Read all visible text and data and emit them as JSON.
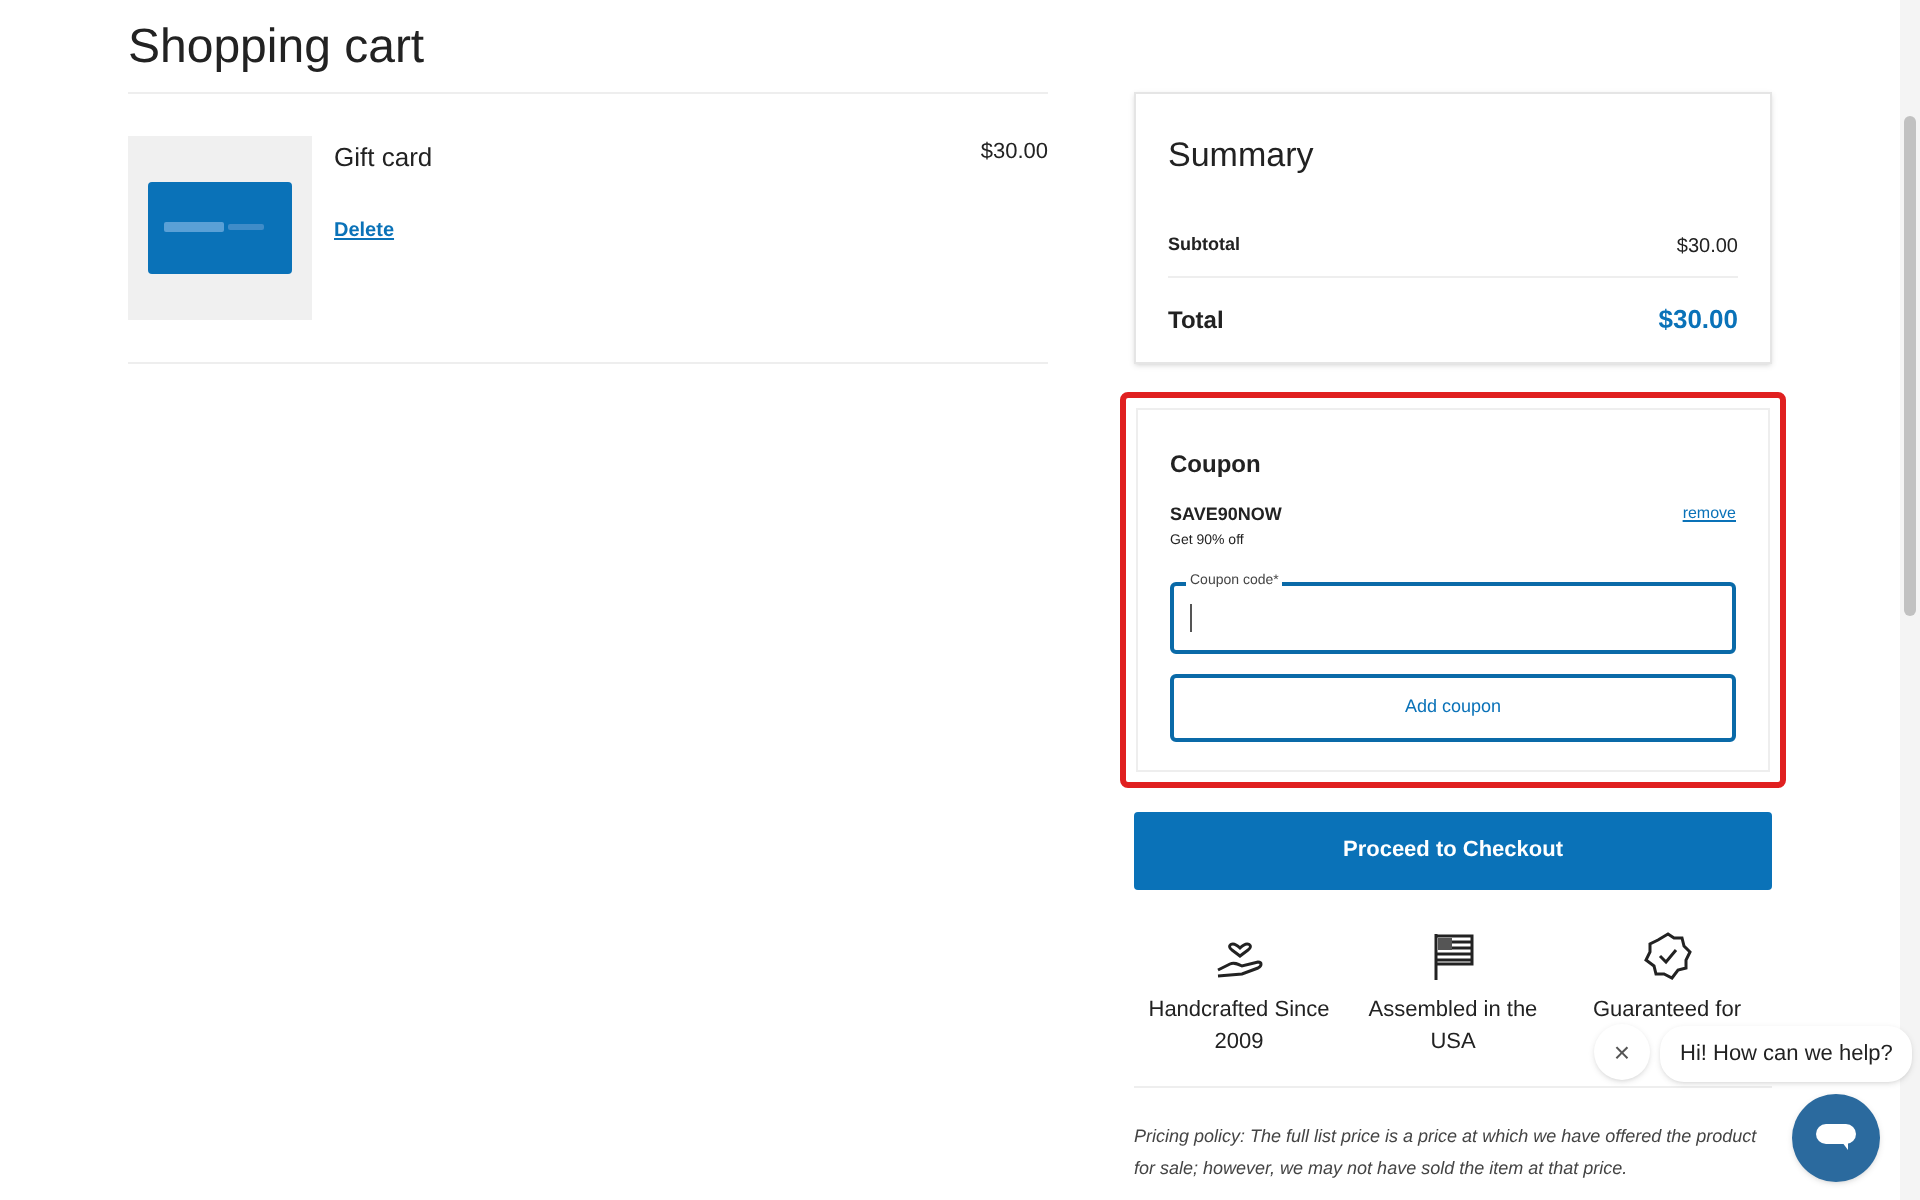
{
  "page": {
    "title": "Shopping cart"
  },
  "cart_items": [
    {
      "name": "Gift card",
      "price": "$30.00",
      "delete": "Delete"
    }
  ],
  "summary": {
    "title": "Summary",
    "subtotal_label": "Subtotal",
    "subtotal": "$30.00",
    "total_label": "Total",
    "total": "$30.00"
  },
  "coupon": {
    "title": "Coupon",
    "code": "SAVE90NOW",
    "description": "Get 90% off",
    "remove": "remove",
    "field": {
      "label": "Coupon code*",
      "focused": true
    },
    "button": "Add coupon",
    "highlighted": true
  },
  "checkout_button": "Proceed to Checkout",
  "features": [
    {
      "kind": "hand-heart",
      "label": "Handcrafted Since 2009"
    },
    {
      "kind": "flag",
      "label": "Assembled in the USA"
    },
    {
      "kind": "badge-check",
      "label": "Guaranteed for"
    }
  ],
  "pricing_policy": "Pricing policy: The full list price is a price at which we have offered the product for sale; however, we may not have sold the item at that price.",
  "chat": {
    "greeting": "Hi! How can we help?",
    "close": "×"
  }
}
